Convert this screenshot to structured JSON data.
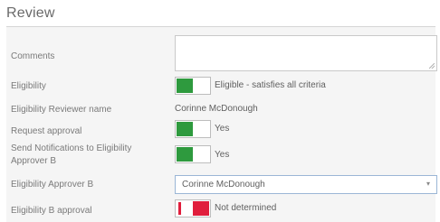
{
  "section": {
    "title": "Review"
  },
  "fields": {
    "comments": {
      "label": "Comments",
      "value": ""
    },
    "eligibility": {
      "label": "Eligibility",
      "value": "Eligible - satisfies all criteria",
      "state": "on"
    },
    "reviewer_name": {
      "label": "Eligibility Reviewer name",
      "value": "Corinne McDonough"
    },
    "request_approval": {
      "label": "Request approval",
      "value": "Yes",
      "state": "on"
    },
    "send_notifications": {
      "label_line1": "Send Notifications to Eligibility",
      "label_line2": "Approver B",
      "value": "Yes",
      "state": "on"
    },
    "approver_b": {
      "label": "Eligibility Approver B",
      "value": "Corinne McDonough"
    },
    "b_approval": {
      "label": "Eligibility B approval",
      "value": "Not determined",
      "state": "off"
    }
  },
  "colors": {
    "toggle_on": "#2e9a3e",
    "toggle_off": "#e01e3c",
    "panel_bg": "#f5f5f5"
  }
}
